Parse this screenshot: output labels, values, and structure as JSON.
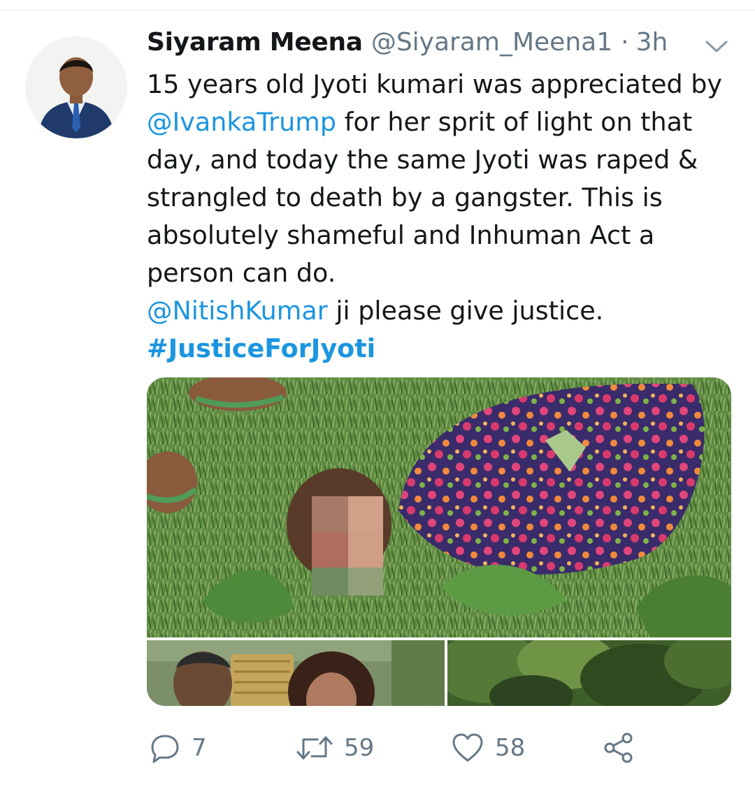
{
  "tweet": {
    "author_name": "Siyaram Meena",
    "handle": "@Siyaram_Meena1",
    "separator": "·",
    "time": "3h",
    "lines": [
      [
        {
          "t": "15 years old Jyoti kumari was appreciated by",
          "k": "text"
        }
      ],
      [
        {
          "t": "@IvankaTrump",
          "k": "mention"
        },
        {
          "t": " for her sprit of light on that",
          "k": "text"
        }
      ],
      [
        {
          "t": "day, and today the same Jyoti was raped &",
          "k": "text"
        }
      ],
      [
        {
          "t": "strangled to death by a gangster. This is",
          "k": "text"
        }
      ],
      [
        {
          "t": "absolutely shameful and Inhuman Act a",
          "k": "text"
        }
      ],
      [
        {
          "t": "person can do.",
          "k": "text"
        }
      ],
      [
        {
          "t": "@NitishKumar",
          "k": "mention"
        },
        {
          "t": " ji please give justice.",
          "k": "text"
        }
      ],
      [
        {
          "t": "#JusticeForJyoti",
          "k": "hashtag"
        }
      ]
    ]
  },
  "actions": {
    "reply_count": "7",
    "retweet_count": "59",
    "like_count": "58"
  },
  "icons": {
    "caret": "chevron-down-icon",
    "reply": "reply-icon",
    "retweet": "retweet-icon",
    "like": "heart-icon",
    "share": "share-icon"
  },
  "colors": {
    "link": "#1b95e0",
    "secondary_text": "#657786",
    "primary_text": "#14171a"
  }
}
